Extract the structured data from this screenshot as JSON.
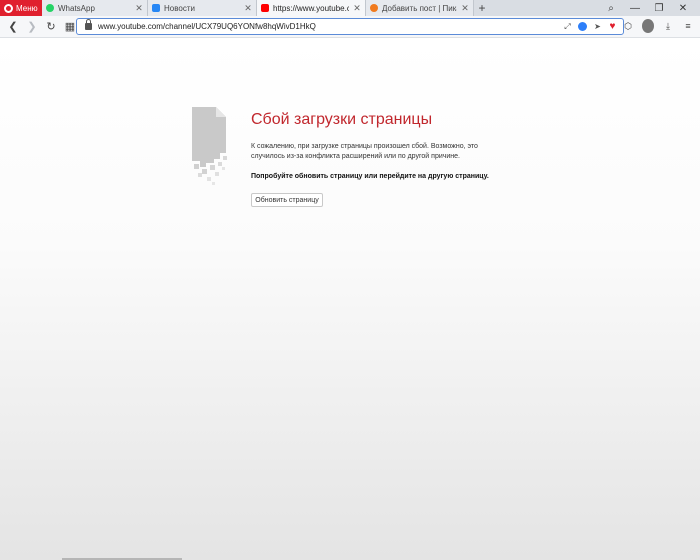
{
  "browser": {
    "menu_label": "Меню",
    "tabs": [
      {
        "title": "WhatsApp",
        "favicon": "whatsapp-icon",
        "active": false
      },
      {
        "title": "Новости",
        "favicon": "vk-icon",
        "active": false
      },
      {
        "title": "https://www.youtube.com/",
        "favicon": "youtube-icon",
        "active": true
      },
      {
        "title": "Добавить пост | Пикабу",
        "favicon": "pikabu-icon",
        "active": false
      }
    ],
    "new_tab_label": "+",
    "url": "www.youtube.com/channel/UCX79UQ6YONfw8hqWivD1HkQ"
  },
  "error_page": {
    "title": "Сбой загрузки страницы",
    "description": "К сожалению, при загрузке страницы произошел сбой. Возможно, это случилось из-за конфликта расширений или по другой причине.",
    "advice": "Попробуйте обновить страницу или перейдите на другую страницу.",
    "reload_button": "Обновить страницу"
  },
  "colors": {
    "accent_red": "#e0202e",
    "error_title": "#c1272d",
    "url_focus": "#5b8bd8"
  }
}
